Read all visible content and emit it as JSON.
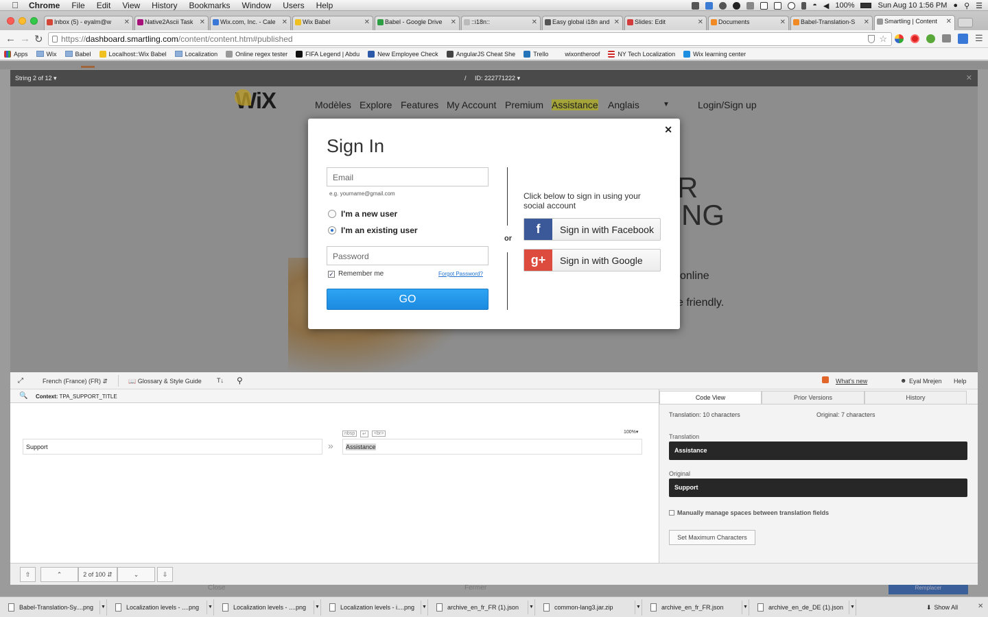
{
  "menubar": {
    "app": "Chrome",
    "items": [
      "File",
      "Edit",
      "View",
      "History",
      "Bookmarks",
      "Window",
      "Users",
      "Help"
    ],
    "battery": "100%",
    "clock": "Sun Aug 10  1:56 PM"
  },
  "tabs": [
    {
      "label": "Inbox (5) - eyalm@w",
      "color": "#d44638"
    },
    {
      "label": "Native2Ascii Task",
      "color": "#a6127a"
    },
    {
      "label": "Wix.com, Inc. - Cale",
      "color": "#3a78d8"
    },
    {
      "label": "Wix Babel",
      "color": "#f0c020"
    },
    {
      "label": "Babel - Google Drive",
      "color": "#2e9e44"
    },
    {
      "label": "::i18n::",
      "color": "#bbbbbb"
    },
    {
      "label": "Easy global i18n and",
      "color": "#555555"
    },
    {
      "label": "Slides: Edit",
      "color": "#d23c3c"
    },
    {
      "label": "Documents",
      "color": "#f08a24"
    },
    {
      "label": "Babel-Translation-S",
      "color": "#f08a24"
    },
    {
      "label": "Smartling | Content",
      "color": "#999999"
    }
  ],
  "omnibox": {
    "scheme": "https://",
    "host": "dashboard.smartling.com",
    "path": "/content/content.htm#published"
  },
  "bookmarks": [
    "Apps",
    "Wix",
    "Babel",
    "Localhost::Wix Babel",
    "Localization",
    "Online regex tester",
    "FIFA Legend | Abdu",
    "New Employee Check",
    "AngularJS Cheat She",
    "Trello",
    "wixontheroof",
    "NY Tech Localization",
    "Wix learning center"
  ],
  "stringbar": {
    "counter": "String 2 of 12",
    "id": "ID: 222771222",
    "sep": "/"
  },
  "wix": {
    "logo": "WiX",
    "nav": [
      "Modèles",
      "Explore",
      "Features",
      "My Account",
      "Premium",
      "Assistance",
      "Anglais"
    ],
    "login": "Login/Sign up",
    "bg1": "R",
    "bg2": "NG",
    "bg3": "online",
    "bg4": "e friendly."
  },
  "signin": {
    "title": "Sign In",
    "email_placeholder": "Email",
    "email_hint": "e.g. yourname@gmail.com",
    "new_user": "I'm a new user",
    "existing_user": "I'm an existing user",
    "password_placeholder": "Password",
    "remember": "Remember me",
    "forgot": "Forgot Password?",
    "go": "GO",
    "or": "or",
    "social_hint": "Click below to sign in using your social account",
    "facebook": "Sign in with Facebook",
    "google": "Sign in with Google"
  },
  "editor": {
    "language": "French (France) (FR)",
    "glossary": "Glossary & Style Guide",
    "whats_new": "What's new",
    "user": "Eyal Mrejen",
    "help": "Help",
    "context_label": "Context:",
    "context_value": "TPA_SUPPORT_TITLE",
    "source_text": "Support",
    "target_text": "Assistance",
    "zoom": "100%",
    "tags": [
      "nbsp",
      "↵",
      "<br>"
    ],
    "page": "2 of 100"
  },
  "panel": {
    "tabs": [
      "Code View",
      "Prior Versions",
      "History"
    ],
    "translation_count": "Translation: 10 characters",
    "original_count": "Original: 7 characters",
    "translation_label": "Translation",
    "translation_value": "Assistance",
    "original_label": "Original",
    "original_value": "Support",
    "manual_spaces": "Manually manage spaces between translation fields",
    "set_max": "Set Maximum Characters"
  },
  "behind": {
    "close": "Close",
    "fermer": "Fermer",
    "btn": "Remplacer"
  },
  "downloads": [
    "Babel-Translation-Sy....png",
    "Localization levels - ....png",
    "Localization levels - ....png",
    "Localization levels - i....png",
    "archive_en_fr_FR (1).json",
    "common-lang3.jar.zip",
    "archive_en_fr_FR.json",
    "archive_en_de_DE (1).json"
  ],
  "show_all": "Show All"
}
